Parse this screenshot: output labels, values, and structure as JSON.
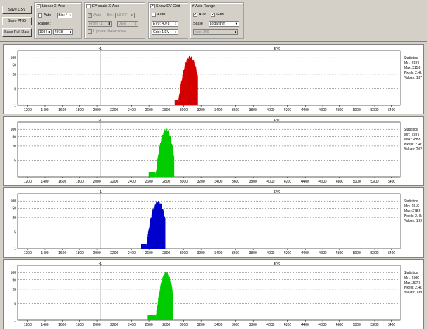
{
  "buttons": {
    "save_csv": "Save CSV",
    "save_png": "Save PNG",
    "save_full": "Save Full Data"
  },
  "linear": {
    "title": "Linear X-Axis",
    "auto": "Auto",
    "bin": "Bin: 4",
    "range_label": "Range:",
    "min": "1084",
    "max": "4078"
  },
  "evscale": {
    "title": "EV-scale X-Axis",
    "auto": "Auto",
    "bin_label": "Bin:",
    "bin": "1/8 EV",
    "from": "From: -1",
    "to": "0 EV",
    "update": "Update linear scale"
  },
  "evgrid": {
    "title": "Show EV Grid",
    "auto": "Auto",
    "ev0": "EV0: 4078",
    "grid": "Grid: 1 EV"
  },
  "yaxis": {
    "title": "Y-Axis Range",
    "auto": "Auto",
    "grid": "Grid",
    "scale_label": "Scale",
    "scale": "Logarithm",
    "max": "Max: 200"
  },
  "axis": {
    "ev_neg": "-1",
    "ev0": "EV0",
    "y_ticks": [
      "100",
      "50",
      "20",
      "5",
      "1"
    ],
    "x_ticks": [
      "1200",
      "1400",
      "1600",
      "1800",
      "2000",
      "2200",
      "2400",
      "2600",
      "2800",
      "3000",
      "3200",
      "3400",
      "3600",
      "3800",
      "4000",
      "4200",
      "4400",
      "4600",
      "4800",
      "5000",
      "5200",
      "5400"
    ]
  },
  "x_range": [
    1084,
    5500
  ],
  "ev_lines": [
    2039,
    4078
  ],
  "panels": [
    {
      "channel": "red",
      "color": "#d40000",
      "center": 3070,
      "spread": 45,
      "peak": 120,
      "stats_title": "Statistics",
      "min": "Min: 2897",
      "max": "Max: 3158",
      "pixels": "Pixels: 2.4k",
      "values": "Values: 187"
    },
    {
      "channel": "green",
      "color": "#00cc00",
      "center": 2795,
      "spread": 40,
      "peak": 110,
      "stats_title": "Statistics",
      "min": "Min: 2597",
      "max": "Max: 2888",
      "pixels": "Pixels: 2.4k",
      "values": "Values: 202"
    },
    {
      "channel": "blue",
      "color": "#0000cc",
      "center": 2700,
      "spread": 45,
      "peak": 105,
      "stats_title": "Statistics",
      "min": "Min: 2510",
      "max": "Max: 2782",
      "pixels": "Pixels: 2.4k",
      "values": "Values: 199"
    },
    {
      "channel": "green2",
      "color": "#00cc00",
      "center": 2795,
      "spread": 40,
      "peak": 105,
      "stats_title": "Statistics",
      "min": "Min: 2586",
      "max": "Max: 2875",
      "pixels": "Pixels: 2.4k",
      "values": "Values: 189"
    }
  ]
}
